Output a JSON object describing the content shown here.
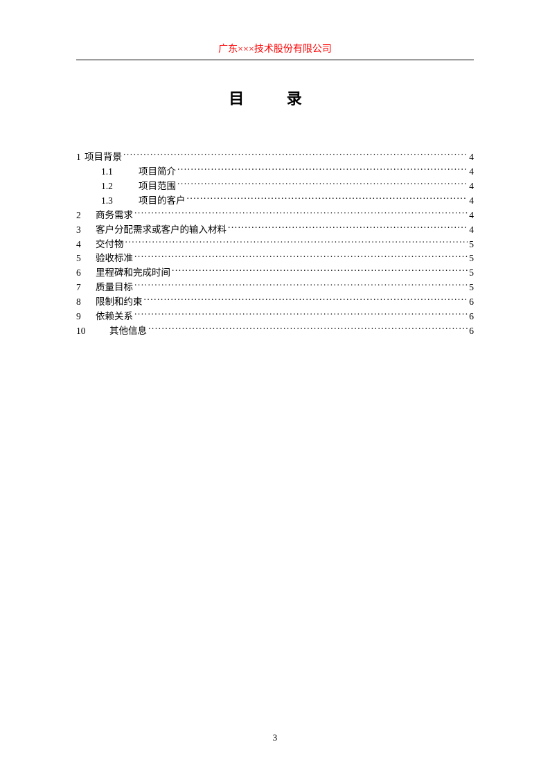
{
  "header": "广东×××技术股份有限公司",
  "title": "目 录",
  "toc": [
    {
      "num": "1",
      "label": "项目背景",
      "page": "4",
      "indent": 0,
      "tight": true
    },
    {
      "num": "1.1",
      "label": "项目简介",
      "page": "4",
      "indent": 1
    },
    {
      "num": "1.2",
      "label": "项目范围",
      "page": "4",
      "indent": 1
    },
    {
      "num": "1.3",
      "label": "项目的客户",
      "page": "4",
      "indent": 1
    },
    {
      "num": "2",
      "label": "商务需求",
      "page": "4",
      "indent": 0
    },
    {
      "num": "3",
      "label": "客户分配需求或客户的输入材料",
      "page": "4",
      "indent": 0
    },
    {
      "num": "4",
      "label": "交付物",
      "page": "5",
      "indent": 0
    },
    {
      "num": "5",
      "label": "验收标准",
      "page": "5",
      "indent": 0
    },
    {
      "num": "6",
      "label": "里程碑和完成时间",
      "page": "5",
      "indent": 0
    },
    {
      "num": "7",
      "label": "质量目标",
      "page": "5",
      "indent": 0
    },
    {
      "num": "8",
      "label": "限制和约束",
      "page": "6",
      "indent": 0
    },
    {
      "num": "9",
      "label": "依赖关系",
      "page": "6",
      "indent": 0
    },
    {
      "num": "10",
      "label": "其他信息",
      "page": "6",
      "indent": 0,
      "wide": true
    }
  ],
  "pageNumber": "3"
}
